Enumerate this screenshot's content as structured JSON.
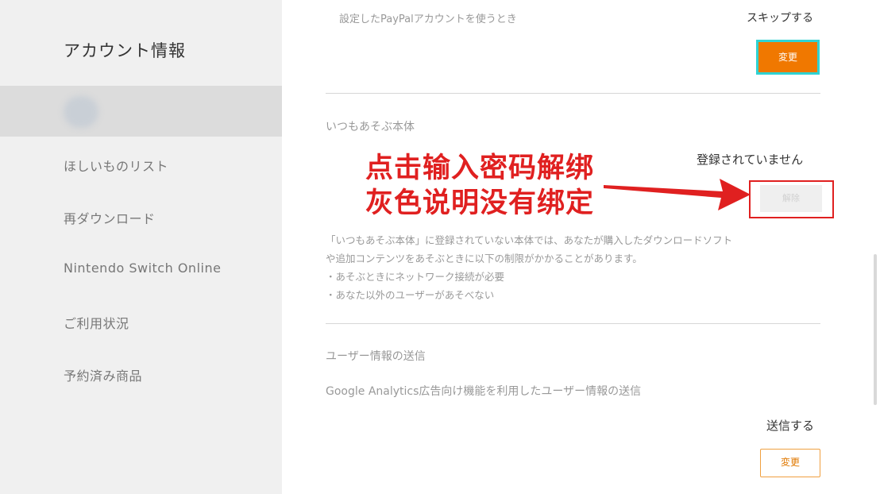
{
  "sidebar": {
    "title": "アカウント情報",
    "items": [
      {
        "label": "ほしいものリスト"
      },
      {
        "label": "再ダウンロード"
      },
      {
        "label": "Nintendo Switch Online"
      },
      {
        "label": "ご利用状況"
      },
      {
        "label": "予約済み商品"
      }
    ]
  },
  "paypal": {
    "description": "設定したPayPalアカウントを使うとき",
    "value": "スキップする",
    "change_label": "変更"
  },
  "primary_console": {
    "heading": "いつもあそぶ本体",
    "status": "登録されていません",
    "unlink_label": "解除",
    "note_lines": [
      "「いつもあそぶ本体」に登録されていない本体では、あなたが購入したダウンロードソフト",
      "や追加コンテンツをあそぶときに以下の制限がかかることがあります。",
      "・あそぶときにネットワーク接続が必要",
      "・あなた以外のユーザーがあそべない"
    ]
  },
  "user_info": {
    "heading": "ユーザー情報の送信",
    "description": "Google Analytics広告向け機能を利用したユーザー情報の送信",
    "value": "送信する",
    "change_label": "変更"
  },
  "annotation": {
    "line1": "点击输入密码解绑",
    "line2": "灰色说明没有绑定"
  },
  "colors": {
    "accent": "#f07800",
    "focus": "#2fd3d3",
    "annotation": "#e02020"
  }
}
